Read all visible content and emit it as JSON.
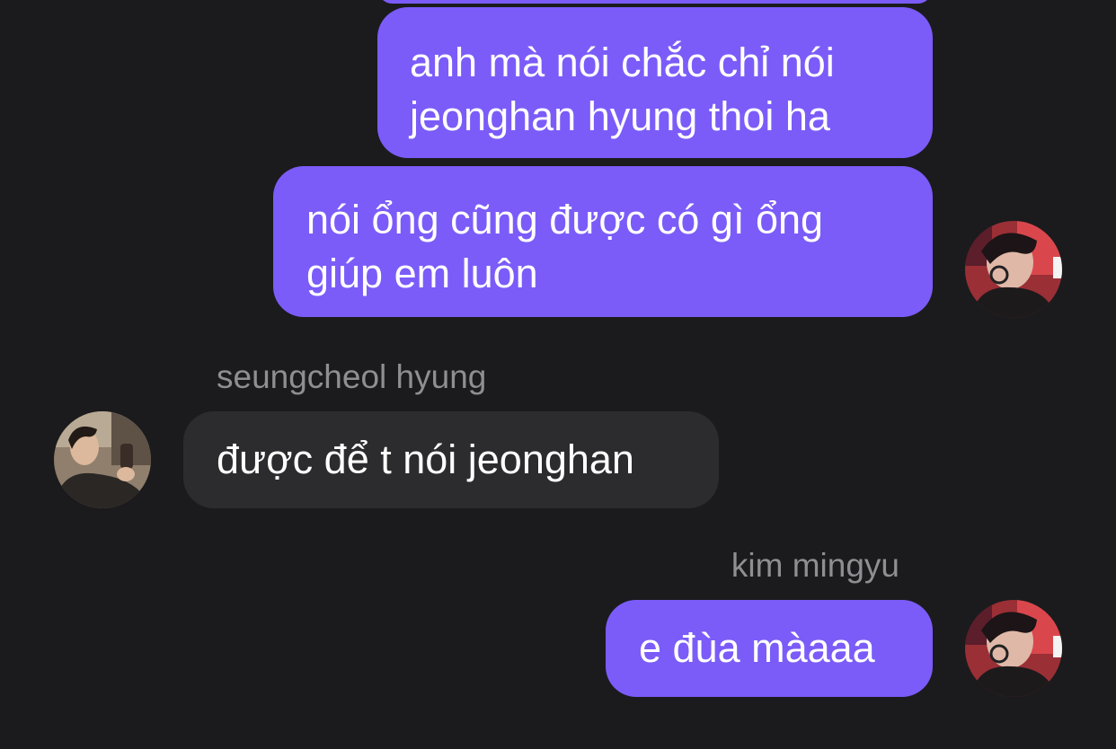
{
  "theme": {
    "background": "#1b1b1d",
    "outgoing_bubble": "#7b5cf9",
    "incoming_bubble": "#2c2c2e",
    "sender_name_color": "#8e8e93"
  },
  "messages": [
    {
      "direction": "outgoing",
      "text": "anh mà nói chắc chỉ nói\njeonghan hyung thoi ha"
    },
    {
      "direction": "outgoing",
      "text": "nói ổng cũng được có gì ổng\ngiúp em luôn"
    },
    {
      "direction": "incoming",
      "sender": "seungcheol hyung",
      "text": "được để t nói jeonghan"
    },
    {
      "direction": "outgoing",
      "sender": "kim mingyu",
      "text": "e đùa màaaa"
    }
  ],
  "avatars": {
    "mingyu": "avatar-kim-mingyu",
    "seungcheol": "avatar-seungcheol-hyung"
  }
}
